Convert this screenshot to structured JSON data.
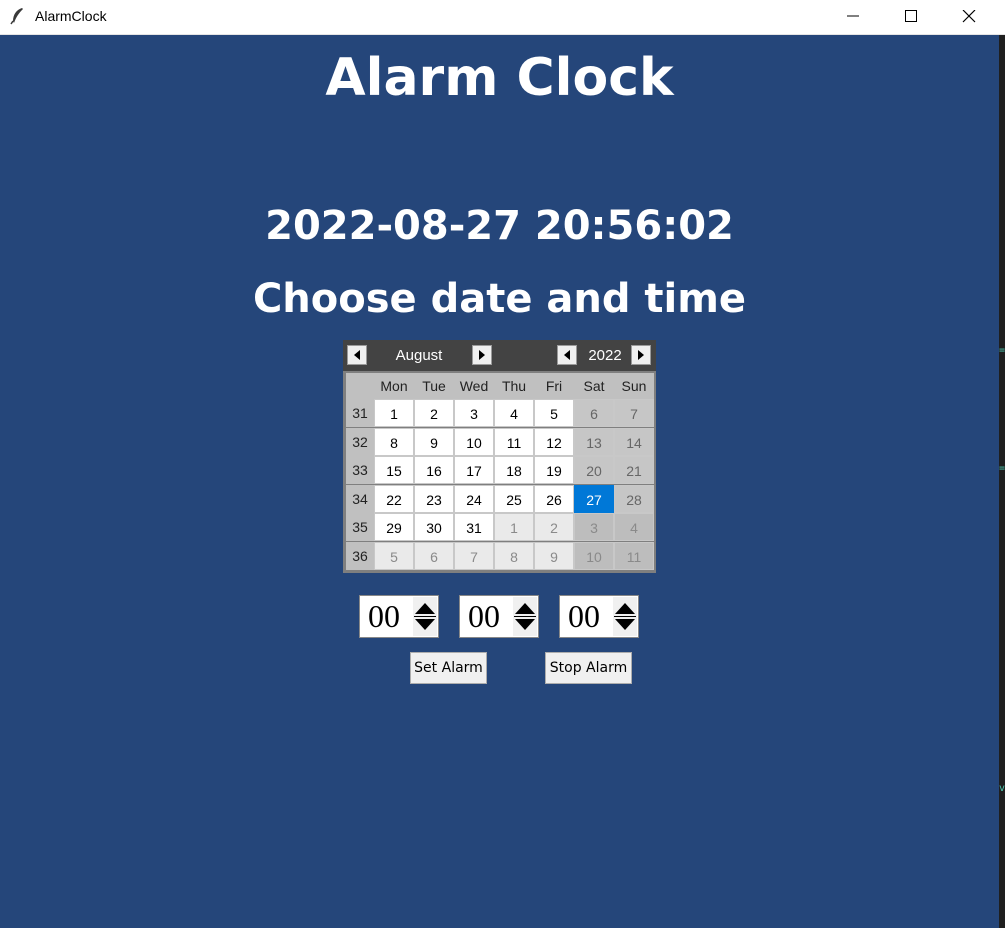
{
  "window": {
    "title": "AlarmClock",
    "controls": [
      "minimize-icon",
      "maximize-icon",
      "close-icon"
    ]
  },
  "app": {
    "title": "Alarm Clock",
    "current_datetime": "2022-08-27 20:56:02",
    "prompt": "Choose date and time"
  },
  "calendar": {
    "month": "August",
    "year": "2022",
    "weekday_headers": [
      "Mon",
      "Tue",
      "Wed",
      "Thu",
      "Fri",
      "Sat",
      "Sun"
    ],
    "weeks": [
      {
        "week": "31",
        "days": [
          "1",
          "2",
          "3",
          "4",
          "5",
          "6",
          "7"
        ]
      },
      {
        "week": "32",
        "days": [
          "8",
          "9",
          "10",
          "11",
          "12",
          "13",
          "14"
        ]
      },
      {
        "week": "33",
        "days": [
          "15",
          "16",
          "17",
          "18",
          "19",
          "20",
          "21"
        ]
      },
      {
        "week": "34",
        "days": [
          "22",
          "23",
          "24",
          "25",
          "26",
          "27",
          "28"
        ]
      },
      {
        "week": "35",
        "days": [
          "29",
          "30",
          "31",
          "1",
          "2",
          "3",
          "4"
        ]
      },
      {
        "week": "36",
        "days": [
          "5",
          "6",
          "7",
          "8",
          "9",
          "10",
          "11"
        ]
      }
    ],
    "selected_day": "27",
    "selected_color": "#0078d7"
  },
  "time_inputs": {
    "hour": "00",
    "minute": "00",
    "second": "00"
  },
  "buttons": {
    "set_alarm": "Set Alarm",
    "stop_alarm": "Stop Alarm"
  },
  "colors": {
    "background": "#25467a",
    "calendar_header": "#434343"
  }
}
